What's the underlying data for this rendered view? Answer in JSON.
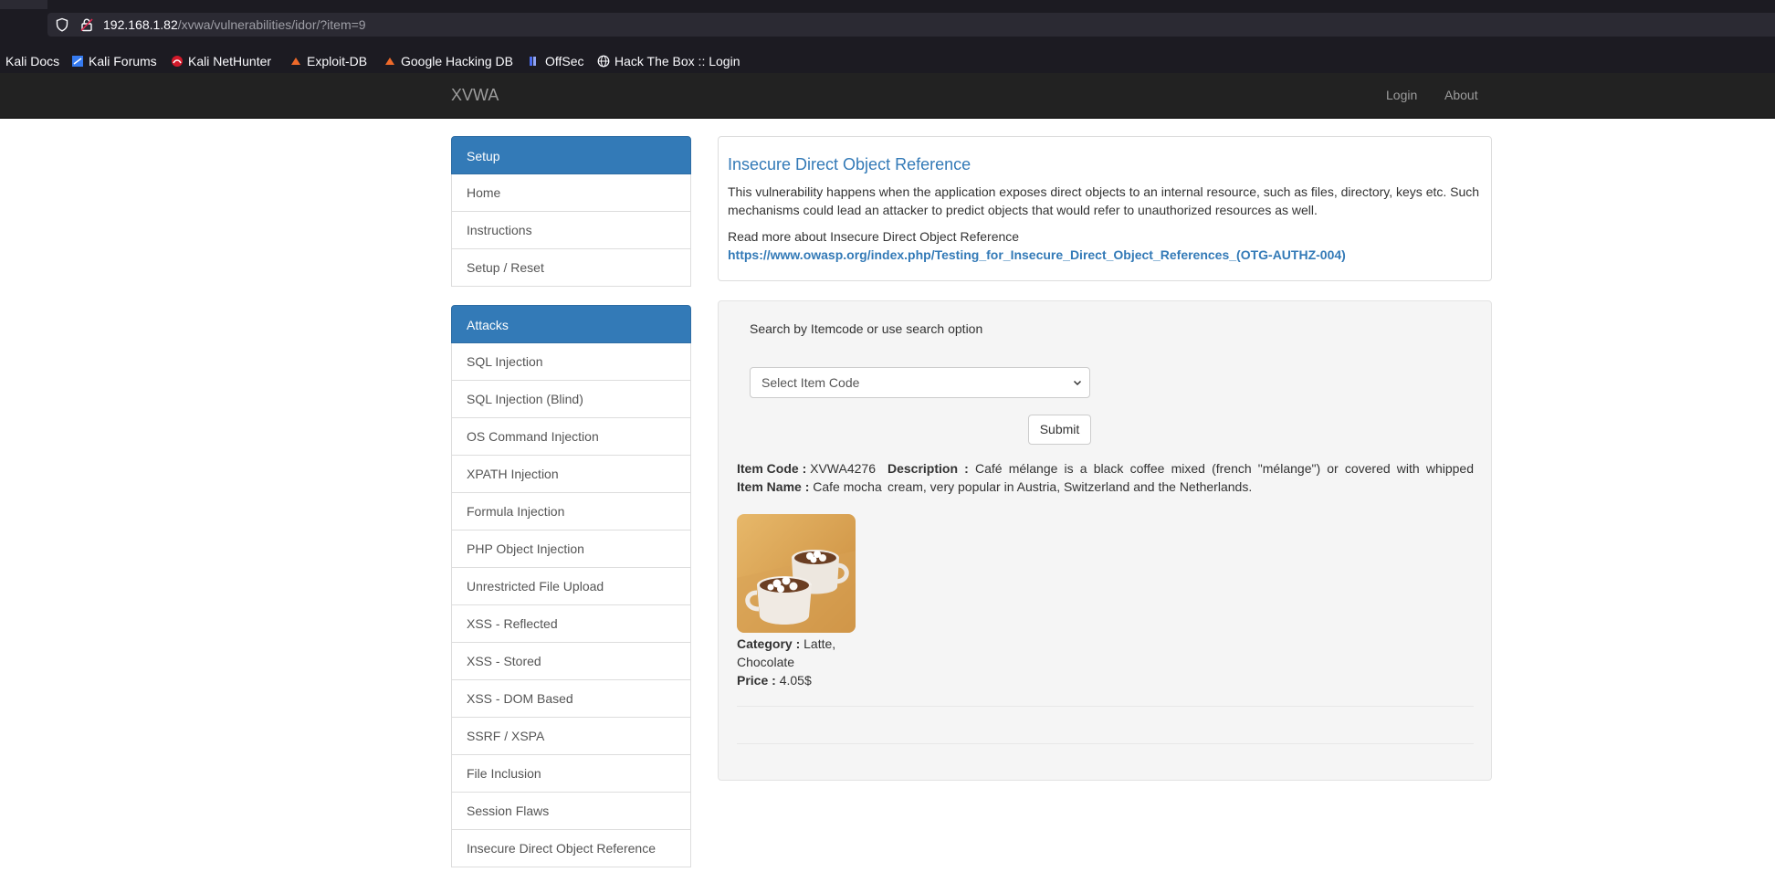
{
  "browser": {
    "url_host": "192.168.1.82",
    "url_path": "/xvwa/vulnerabilities/idor/?item=9",
    "bookmarks": [
      "Kali Docs",
      "Kali Forums",
      "Kali NetHunter",
      "Exploit-DB",
      "Google Hacking DB",
      "OffSec",
      "Hack The Box :: Login"
    ]
  },
  "navbar": {
    "brand": "XVWA",
    "links": [
      "Login",
      "About"
    ]
  },
  "sidebar": {
    "setup_title": "Setup",
    "setup_items": [
      "Home",
      "Instructions",
      "Setup / Reset"
    ],
    "attacks_title": "Attacks",
    "attack_items": [
      "SQL Injection",
      "SQL Injection (Blind)",
      "OS Command Injection",
      "XPATH Injection",
      "Formula Injection",
      "PHP Object Injection",
      "Unrestricted File Upload",
      "XSS - Reflected",
      "XSS - Stored",
      "XSS - DOM Based",
      "SSRF / XSPA",
      "File Inclusion",
      "Session Flaws",
      "Insecure Direct Object Reference"
    ]
  },
  "intro": {
    "title": "Insecure Direct Object Reference",
    "description": "This vulnerability happens when the application exposes direct objects to an internal resource, such as files, directory, keys etc. Such mechanisms could lead an attacker to predict objects that would refer to unauthorized resources as well.",
    "read_more": "Read more about Insecure Direct Object Reference",
    "link": "https://www.owasp.org/index.php/Testing_for_Insecure_Direct_Object_References_(OTG-AUTHZ-004)"
  },
  "search": {
    "label": "Search by Itemcode or use search option",
    "select_value": "Select Item Code",
    "submit_label": "Submit"
  },
  "item": {
    "code_label": "Item Code :",
    "code": "XVWA4276",
    "name_label": "Item Name :",
    "name": "Cafe mocha",
    "category_label": "Category :",
    "category": "Latte, Chocolate",
    "price_label": "Price :",
    "price": "4.05$",
    "description_label": "Description :",
    "description": "Café mélange is a black coffee mixed (french \"mélange\") or covered with whipped cream, very popular in Austria, Switzerland and the Netherlands."
  },
  "colors": {
    "primary": "#337ab7",
    "navbar": "#222222",
    "well": "#f5f5f5"
  }
}
